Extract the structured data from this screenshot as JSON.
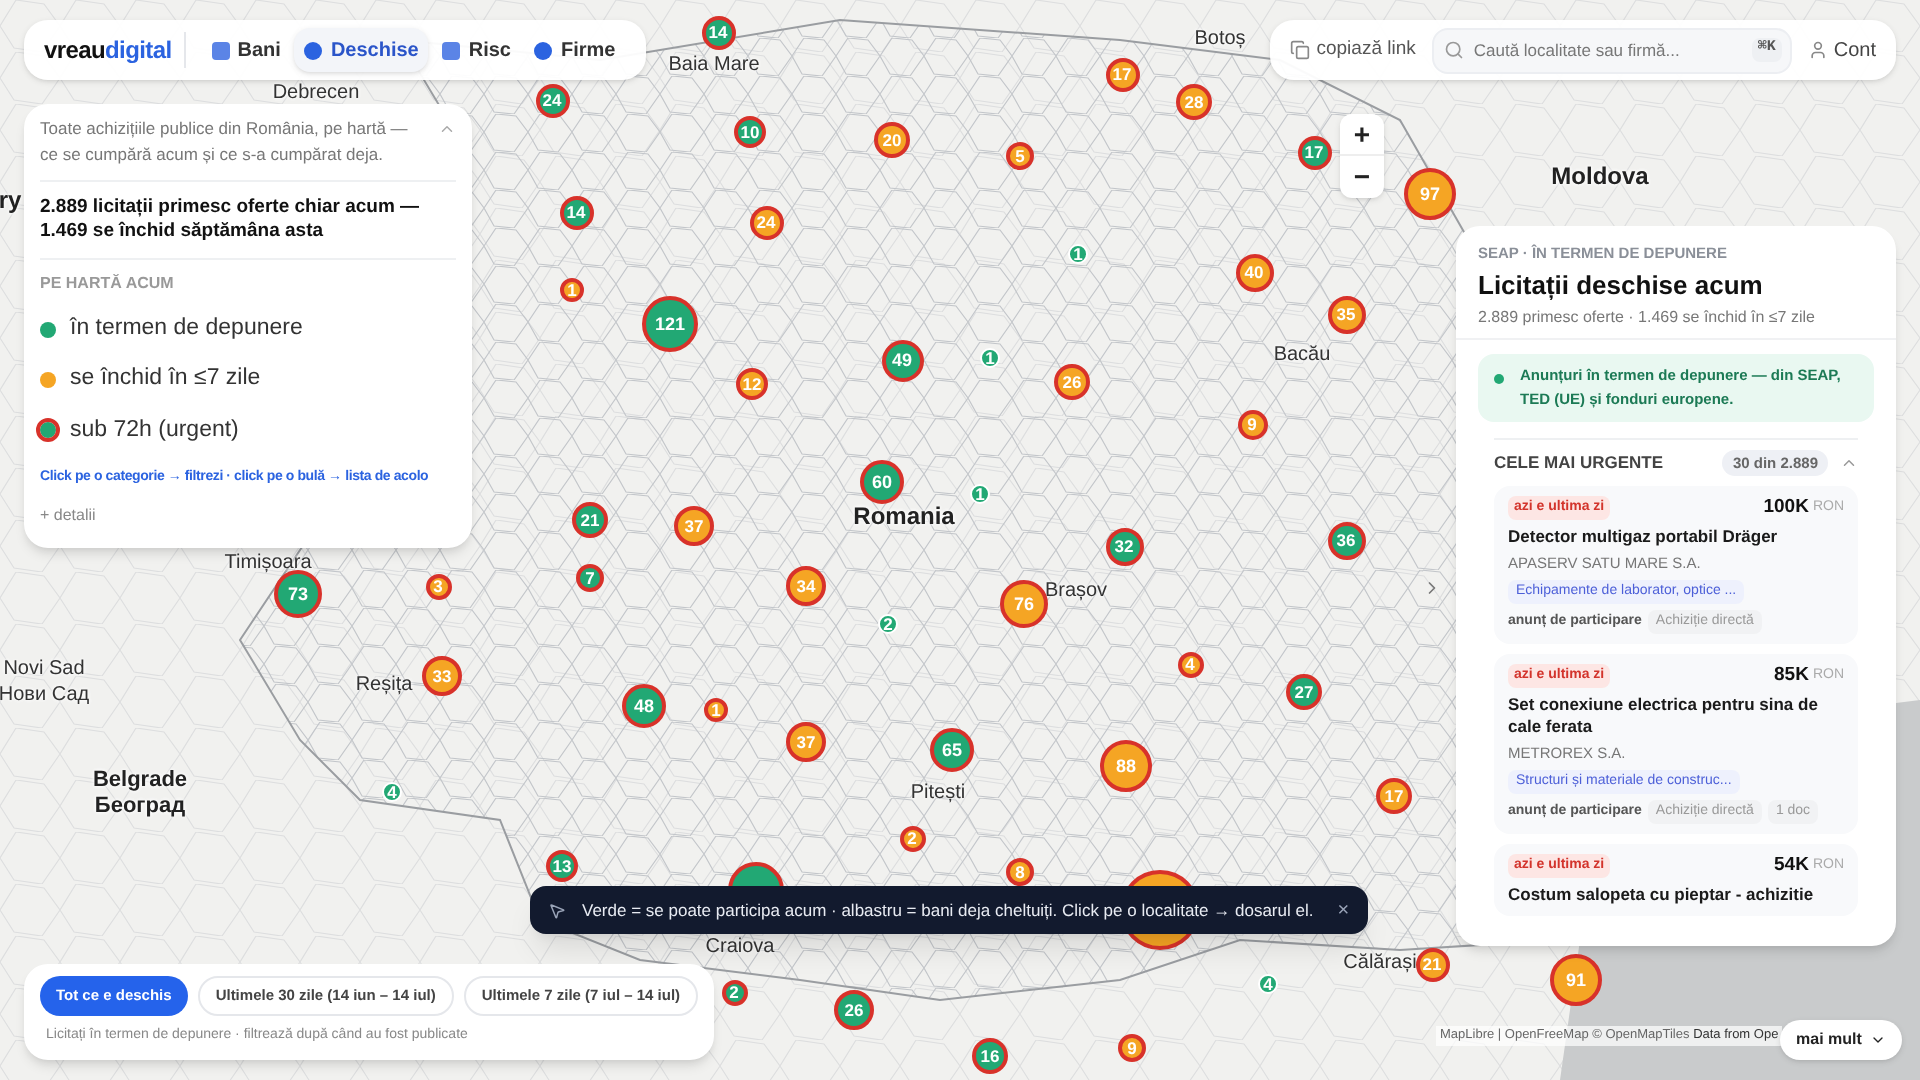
{
  "header": {
    "logo_a": "vreau",
    "logo_b": "digital",
    "tabs": [
      {
        "label": "Bani",
        "kind": "square",
        "selected": false
      },
      {
        "label": "Deschise",
        "kind": "circle",
        "selected": true
      },
      {
        "label": "Risc",
        "kind": "square",
        "selected": false
      },
      {
        "label": "Firme",
        "kind": "circle",
        "selected": false
      }
    ],
    "copy_link": "copiază link",
    "search": {
      "placeholder": "Caută localitate sau firmă...",
      "shortcut": "⌘K"
    },
    "account": "Cont"
  },
  "intro_panel": {
    "intro": "Toate achizițiile publice din România, pe hartă — ce se cumpără acum și ce s-a cumpărat deja.",
    "expanded": true,
    "stats": "2.889 licitații primesc oferte chiar acum — 1.469 se închid săptămâna asta",
    "legend_heading": "PE HARTĂ ACUM",
    "legend": [
      {
        "label": "în termen de depunere",
        "color": "#22a874",
        "urgent": false
      },
      {
        "label": "se închid în ≤7 zile",
        "color": "#f5a524",
        "urgent": false
      },
      {
        "label": "sub 72h (urgent)",
        "color": "#22a874",
        "urgent": true
      }
    ],
    "hint": "Click pe o categorie → filtrezi · click pe o bulă → lista de acolo",
    "details": "+ detalii"
  },
  "map": {
    "places": [
      {
        "label": "Debrecen",
        "kind": "city"
      },
      {
        "label": "Baia Mare",
        "kind": "city"
      },
      {
        "label": "Botoș",
        "kind": "city"
      },
      {
        "label": "Moldova",
        "kind": "country"
      },
      {
        "label": "ry",
        "kind": "country"
      },
      {
        "label": "Bacău",
        "kind": "city"
      },
      {
        "label": "Romania",
        "kind": "country"
      },
      {
        "label": "Brașov",
        "kind": "city"
      },
      {
        "label": "Timișoara",
        "kind": "city"
      },
      {
        "label": "Novi Sad",
        "kind": "city"
      },
      {
        "label": "Нови Сад",
        "kind": "city"
      },
      {
        "label": "Reșița",
        "kind": "city"
      },
      {
        "label": "Belgrade",
        "kind": "capital"
      },
      {
        "label": "Београд",
        "kind": "capital"
      },
      {
        "label": "Pitești",
        "kind": "city"
      },
      {
        "label": "Craiova",
        "kind": "city"
      },
      {
        "label": "Călărași",
        "kind": "city"
      }
    ],
    "bubbles": [
      {
        "label": "14",
        "color": "#22a874",
        "urgent": true
      },
      {
        "label": "24",
        "color": "#22a874",
        "urgent": true
      },
      {
        "label": "17",
        "color": "#f5a524",
        "urgent": true
      },
      {
        "label": "28",
        "color": "#f5a524",
        "urgent": true
      },
      {
        "label": "10",
        "color": "#22a874",
        "urgent": true
      },
      {
        "label": "20",
        "color": "#f5a524",
        "urgent": true
      },
      {
        "label": "5",
        "color": "#f5a524",
        "urgent": true
      },
      {
        "label": "17",
        "color": "#22a874",
        "urgent": true
      },
      {
        "label": "97",
        "color": "#f5a524",
        "urgent": true
      },
      {
        "label": "14",
        "color": "#22a874",
        "urgent": true
      },
      {
        "label": "24",
        "color": "#f5a524",
        "urgent": true
      },
      {
        "label": "1",
        "color": "#22a874",
        "urgent": false
      },
      {
        "label": "40",
        "color": "#f5a524",
        "urgent": true
      },
      {
        "label": "1",
        "color": "#f5a524",
        "urgent": true
      },
      {
        "label": "121",
        "color": "#22a874",
        "urgent": true
      },
      {
        "label": "35",
        "color": "#f5a524",
        "urgent": true
      },
      {
        "label": "49",
        "color": "#22a874",
        "urgent": true
      },
      {
        "label": "1",
        "color": "#22a874",
        "urgent": false
      },
      {
        "label": "26",
        "color": "#f5a524",
        "urgent": true
      },
      {
        "label": "12",
        "color": "#f5a524",
        "urgent": true
      },
      {
        "label": "9",
        "color": "#f5a524",
        "urgent": true
      },
      {
        "label": "60",
        "color": "#22a874",
        "urgent": true
      },
      {
        "label": "1",
        "color": "#22a874",
        "urgent": false
      },
      {
        "label": "21",
        "color": "#22a874",
        "urgent": true
      },
      {
        "label": "37",
        "color": "#f5a524",
        "urgent": true
      },
      {
        "label": "32",
        "color": "#22a874",
        "urgent": true
      },
      {
        "label": "36",
        "color": "#22a874",
        "urgent": true
      },
      {
        "label": "73",
        "color": "#22a874",
        "urgent": true
      },
      {
        "label": "3",
        "color": "#f5a524",
        "urgent": true
      },
      {
        "label": "7",
        "color": "#22a874",
        "urgent": true
      },
      {
        "label": "34",
        "color": "#f5a524",
        "urgent": true
      },
      {
        "label": "76",
        "color": "#f5a524",
        "urgent": true
      },
      {
        "label": "2",
        "color": "#22a874",
        "urgent": false
      },
      {
        "label": "4",
        "color": "#f5a524",
        "urgent": true
      },
      {
        "label": "33",
        "color": "#f5a524",
        "urgent": true
      },
      {
        "label": "27",
        "color": "#22a874",
        "urgent": true
      },
      {
        "label": "48",
        "color": "#22a874",
        "urgent": true
      },
      {
        "label": "1",
        "color": "#f5a524",
        "urgent": true
      },
      {
        "label": "65",
        "color": "#22a874",
        "urgent": true
      },
      {
        "label": "37",
        "color": "#f5a524",
        "urgent": true
      },
      {
        "label": "88",
        "color": "#f5a524",
        "urgent": true
      },
      {
        "label": "4",
        "color": "#22a874",
        "urgent": false
      },
      {
        "label": "17",
        "color": "#f5a524",
        "urgent": true
      },
      {
        "label": "2",
        "color": "#f5a524",
        "urgent": true
      },
      {
        "label": "13",
        "color": "#22a874",
        "urgent": true
      },
      {
        "label": "8",
        "color": "#f5a524",
        "urgent": true
      },
      {
        "color": "#22a874",
        "urgent": true
      },
      {
        "color": "#f5a524",
        "urgent": true
      },
      {
        "label": "21",
        "color": "#f5a524",
        "urgent": true
      },
      {
        "label": "2",
        "color": "#22a874",
        "urgent": true
      },
      {
        "label": "26",
        "color": "#22a874",
        "urgent": true
      },
      {
        "label": "4",
        "color": "#22a874",
        "urgent": false
      },
      {
        "label": "91",
        "color": "#f5a524",
        "urgent": true
      },
      {
        "label": "16",
        "color": "#22a874",
        "urgent": true
      },
      {
        "label": "9",
        "color": "#f5a524",
        "urgent": true
      }
    ],
    "zoom_in": "+",
    "zoom_out": "−",
    "attribution_a": "MapLibre | OpenFreeMap © OpenMapTiles",
    "attribution_b": "Data from Ope",
    "more": "mai mult"
  },
  "results_panel": {
    "eyebrow": "SEAP · ÎN TERMEN DE DEPUNERE",
    "title": "Licitații deschise acum",
    "subtitle": "2.889 primesc oferte · 1.469 se închid în ≤7 zile",
    "notice": "Anunțuri în termen de depunere — din SEAP, TED (UE) și fonduri europene.",
    "section": "CELE MAI URGENTE",
    "count": "30 din 2.889",
    "expanded": true,
    "cards": [
      {
        "deadline": "azi e ultima zi",
        "amount": "100K",
        "currency": "RON",
        "title": "Detector multigaz portabil Dräger",
        "buyer": "APASERV SATU MARE S.A.",
        "category": "Echipamente de laborator, optice ...",
        "notice_type": "anunț de participare",
        "procedure": "Achiziție directă"
      },
      {
        "deadline": "azi e ultima zi",
        "amount": "85K",
        "currency": "RON",
        "title": "Set conexiune electrica pentru sina de cale ferata",
        "buyer": "METROREX S.A.",
        "category": "Structuri și materiale de construc...",
        "notice_type": "anunț de participare",
        "procedure": "Achiziție directă",
        "docs": "1 doc"
      },
      {
        "deadline": "azi e ultima zi",
        "amount": "54K",
        "currency": "RON",
        "title": "Costum salopeta cu pieptar - achizitie"
      }
    ]
  },
  "toast": {
    "text": "Verde = se poate participa acum · albastru = bani deja cheltuiți. Click pe o localitate → dosarul el.",
    "close": "×"
  },
  "period": {
    "options": [
      {
        "label": "Tot ce e deschis",
        "selected": true
      },
      {
        "label": "Ultimele 30 zile (14 iun – 14 iul)",
        "selected": false
      },
      {
        "label": "Ultimele 7 zile (7 iul – 14 iul)",
        "selected": false
      }
    ],
    "caption": "Licitați în termen de depunere · filtrează după când au fost publicate"
  }
}
